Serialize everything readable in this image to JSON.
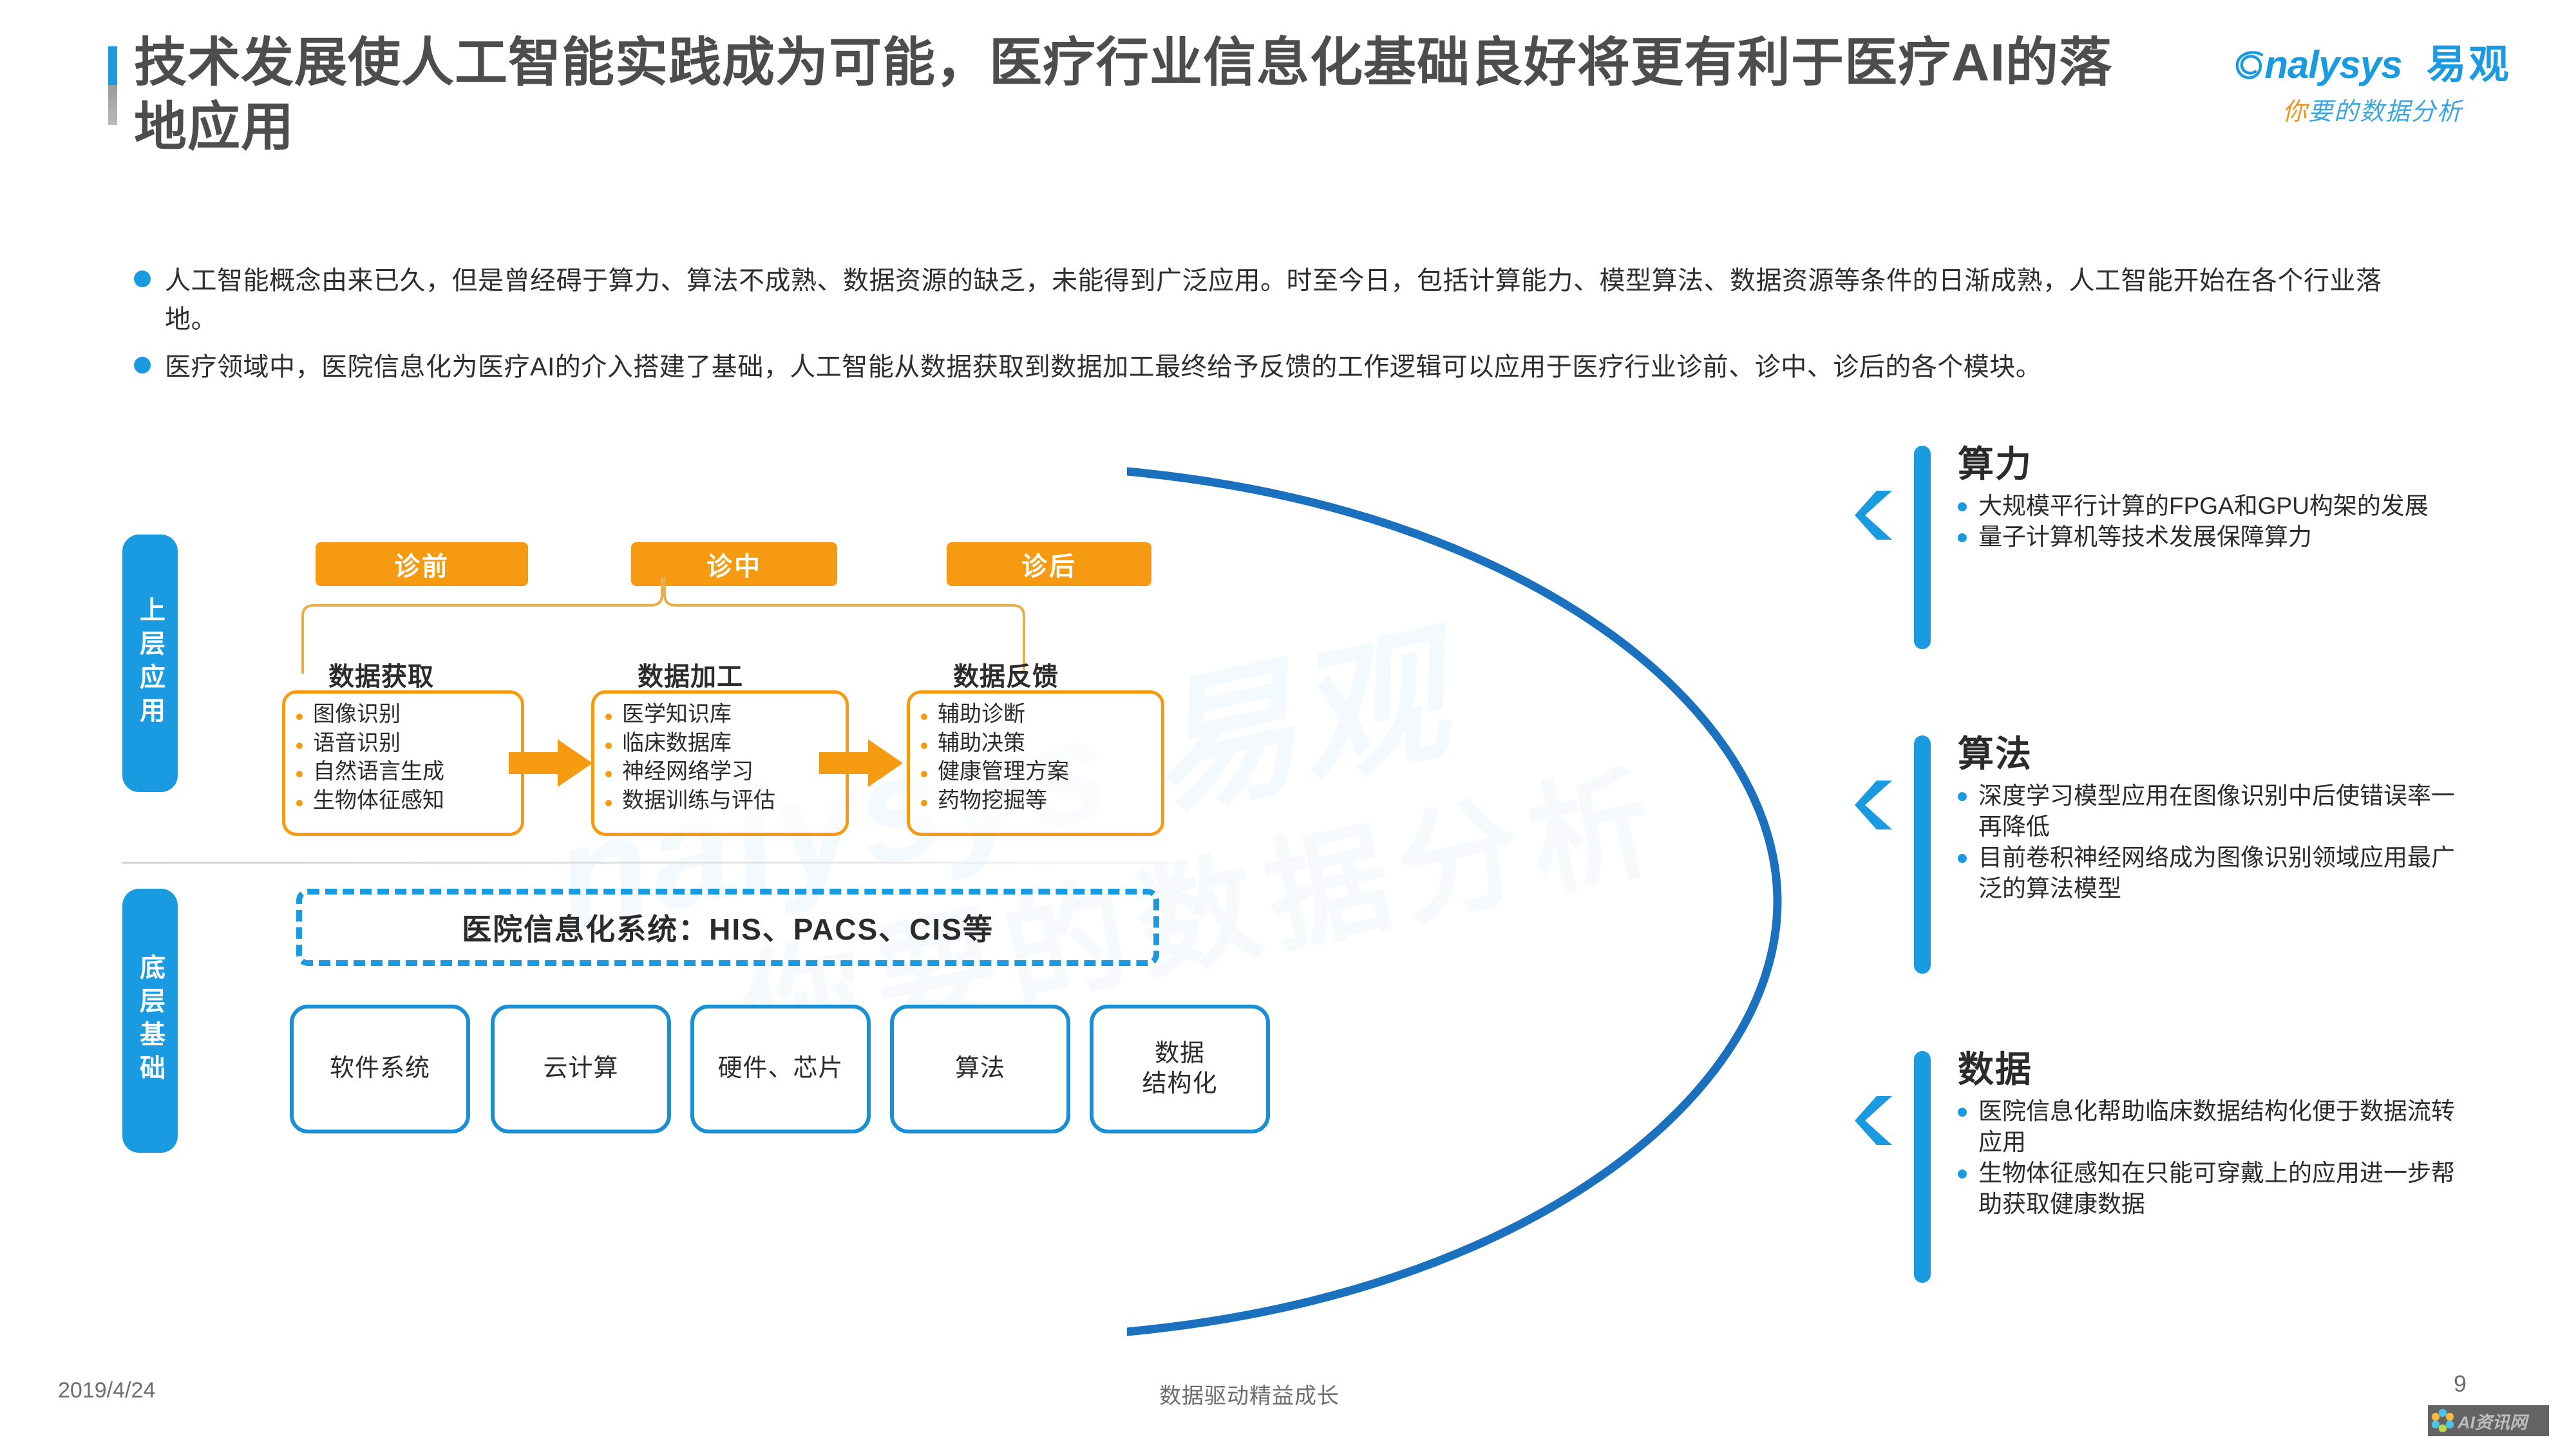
{
  "header": {
    "title": "技术发展使人工智能实践成为可能，医疗行业信息化基础良好将更有利于医疗AI的落地应用",
    "logo_en": "nalysys",
    "logo_cn": "易观",
    "logo_tagline_accent": "你",
    "logo_tagline_rest": "要的数据分析",
    "accent_blue": "#1a9ae0",
    "accent_orange": "#f0931e"
  },
  "intro": {
    "bullets": [
      "人工智能概念由来已久，但是曾经碍于算力、算法不成熟、数据资源的缺乏，未能得到广泛应用。时至今日，包括计算能力、模型算法、数据资源等条件的日渐成熟，人工智能开始在各个行业落地。",
      "医疗领域中，医院信息化为医疗AI的介入搭建了基础，人工智能从数据获取到数据加工最终给予反馈的工作逻辑可以应用于医疗行业诊前、诊中、诊后的各个模块。"
    ]
  },
  "watermark": {
    "line1": "nalysys 易观",
    "line2": "你要的数据分析"
  },
  "diagram": {
    "layers": [
      {
        "label": "上层应用"
      },
      {
        "label": "底层基础"
      }
    ],
    "phases": [
      "诊前",
      "诊中",
      "诊后"
    ],
    "stages": [
      {
        "title": "数据获取",
        "items": [
          "图像识别",
          "语音识别",
          "自然语言生成",
          "生物体征感知"
        ]
      },
      {
        "title": "数据加工",
        "items": [
          "医学知识库",
          "临床数据库",
          "神经网络学习",
          "数据训练与评估"
        ]
      },
      {
        "title": "数据反馈",
        "items": [
          "辅助诊断",
          "辅助决策",
          "健康管理方案",
          "药物挖掘等"
        ]
      }
    ],
    "his_label": "医院信息化系统：HIS、PACS、CIS等",
    "base_cards": [
      "软件系统",
      "云计算",
      "硬件、芯片",
      "算法",
      "数据\n结构化"
    ],
    "box_border_color": "#f59a11",
    "base_border_color": "#1a8fd4"
  },
  "right_panel": {
    "pillars": [
      {
        "title": "算力",
        "items": [
          "大规模平行计算的FPGA和GPU构架的发展",
          "量子计算机等技术发展保障算力"
        ]
      },
      {
        "title": "算法",
        "items": [
          "深度学习模型应用在图像识别中后使错误率一再降低",
          "目前卷积神经网络成为图像识别领域应用最广泛的算法模型"
        ]
      },
      {
        "title": "数据",
        "items": [
          "医院信息化帮助临床数据结构化便于数据流转应用",
          "生物体征感知在只能可穿戴上的应用进一步帮助获取健康数据"
        ]
      }
    ]
  },
  "footer": {
    "date": "2019/4/24",
    "center": "数据驱动精益成长",
    "page": "9",
    "watermark_badge": "AI资讯网"
  }
}
